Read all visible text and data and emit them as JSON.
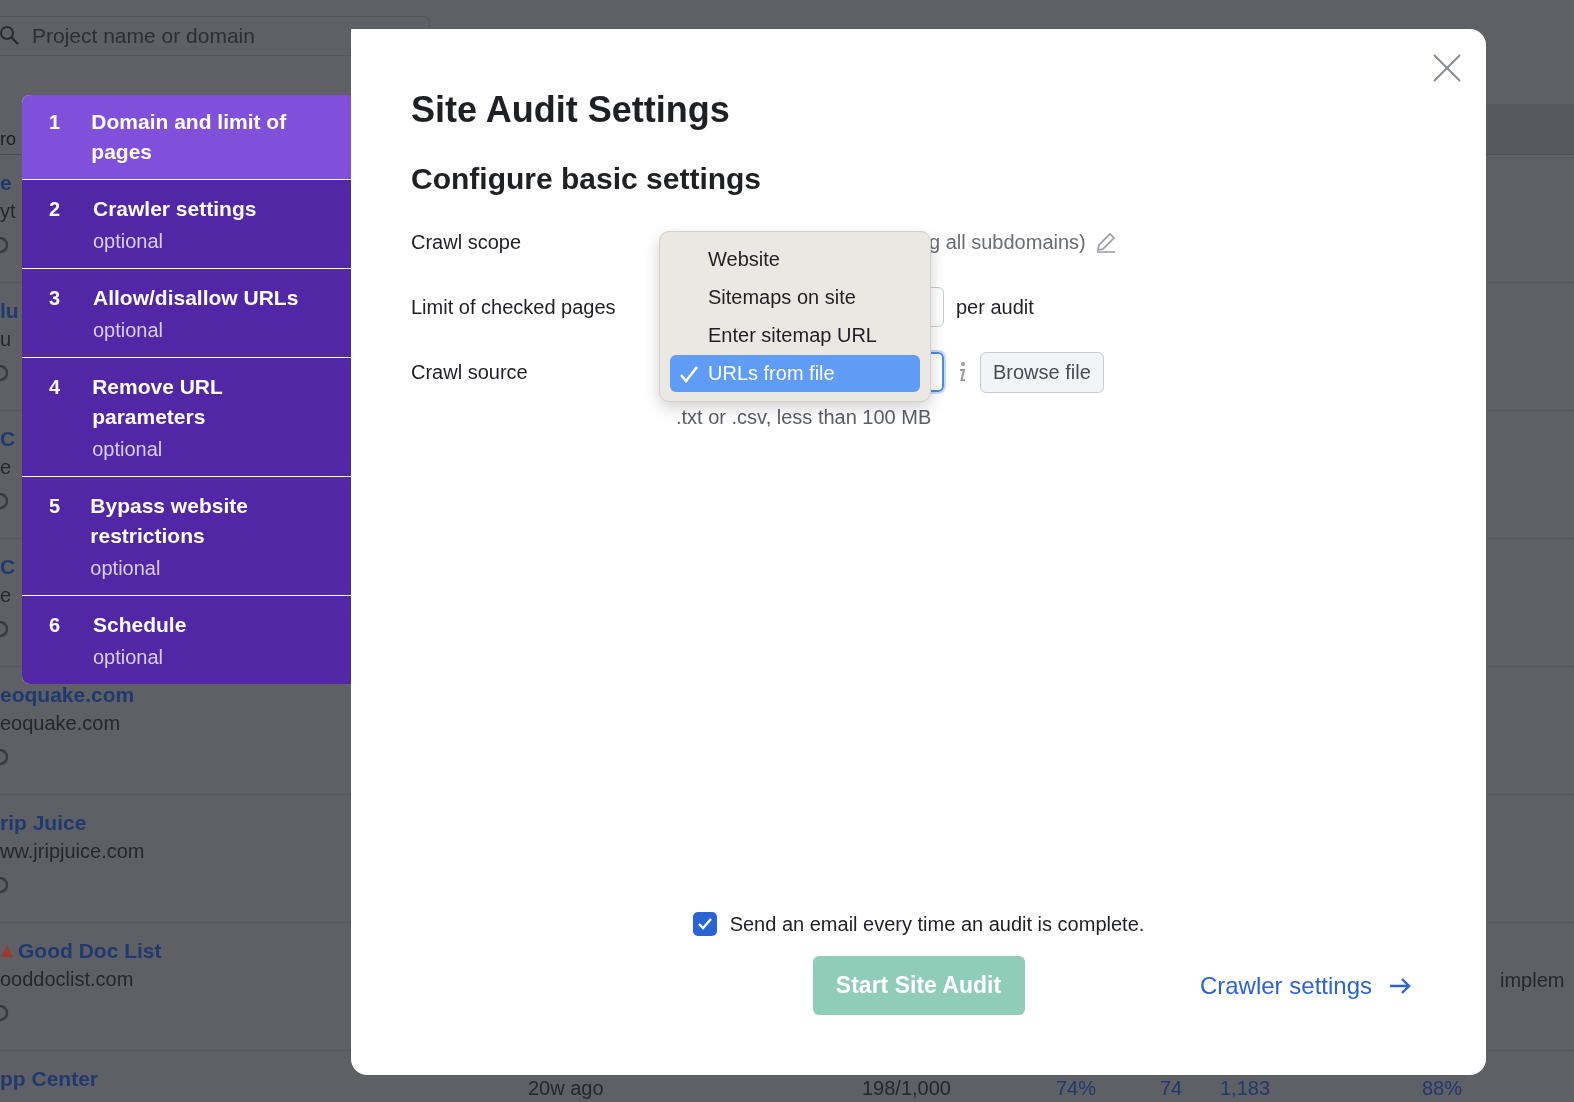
{
  "background": {
    "search": {
      "placeholder": "Project name or domain"
    },
    "header_fragment": "ro",
    "rows": [
      {
        "title": "e",
        "domain": "yt",
        "warning": false,
        "gear": true
      },
      {
        "title": "lu",
        "domain": "u",
        "warning": false,
        "gear": true
      },
      {
        "title": "C",
        "domain": "e",
        "warning": false,
        "gear": true
      },
      {
        "title": "C",
        "domain": "e",
        "warning": false,
        "gear": true
      },
      {
        "title": "eoquake.com",
        "domain": "eoquake.com",
        "warning": false,
        "gear": true
      },
      {
        "title": "rip Juice",
        "domain": "ww.jripjuice.com",
        "warning": false,
        "gear": true
      },
      {
        "title": "Good Doc List",
        "domain": "ooddoclist.com",
        "warning": true,
        "gear": true,
        "note": "implem"
      },
      {
        "title": "pp Center",
        "warning": false,
        "gear": false,
        "cells": [
          "20w ago",
          "198/1,000",
          "74%",
          "74",
          "1,183",
          "88%"
        ]
      }
    ]
  },
  "steps": [
    {
      "number": "1",
      "title": "Domain and limit of pages",
      "selected": true
    },
    {
      "number": "2",
      "title": "Crawler settings",
      "subtitle": "optional",
      "selected": false
    },
    {
      "number": "3",
      "title": "Allow/disallow URLs",
      "subtitle": "optional",
      "selected": false
    },
    {
      "number": "4",
      "title": "Remove URL parameters",
      "subtitle": "optional",
      "selected": false
    },
    {
      "number": "5",
      "title": "Bypass website restrictions",
      "subtitle": "optional",
      "selected": false
    },
    {
      "number": "6",
      "title": "Schedule",
      "subtitle": "optional",
      "selected": false
    }
  ],
  "modal": {
    "title": "Site Audit Settings",
    "subtitle": "Configure basic settings",
    "fields": [
      {
        "kind": "scope",
        "label": "Crawl scope",
        "value": "g all subdomains)"
      },
      {
        "kind": "limit",
        "label": "Limit of checked pages",
        "suffix": "per audit"
      },
      {
        "kind": "source",
        "label": "Crawl source",
        "button": "Browse file",
        "hint": ".txt or .csv, less than 100 MB"
      }
    ],
    "dropdown": {
      "options": [
        {
          "label": "Website",
          "selected": false
        },
        {
          "label": "Sitemaps on site",
          "selected": false
        },
        {
          "label": "Enter sitemap URL",
          "selected": false
        },
        {
          "label": "URLs from file",
          "selected": true
        }
      ]
    },
    "email": {
      "label": "Send an email every time an audit is complete.",
      "checked": true
    },
    "start_button": {
      "label": "Start Site Audit",
      "disabled": true
    },
    "next_link": "Crawler settings"
  }
}
